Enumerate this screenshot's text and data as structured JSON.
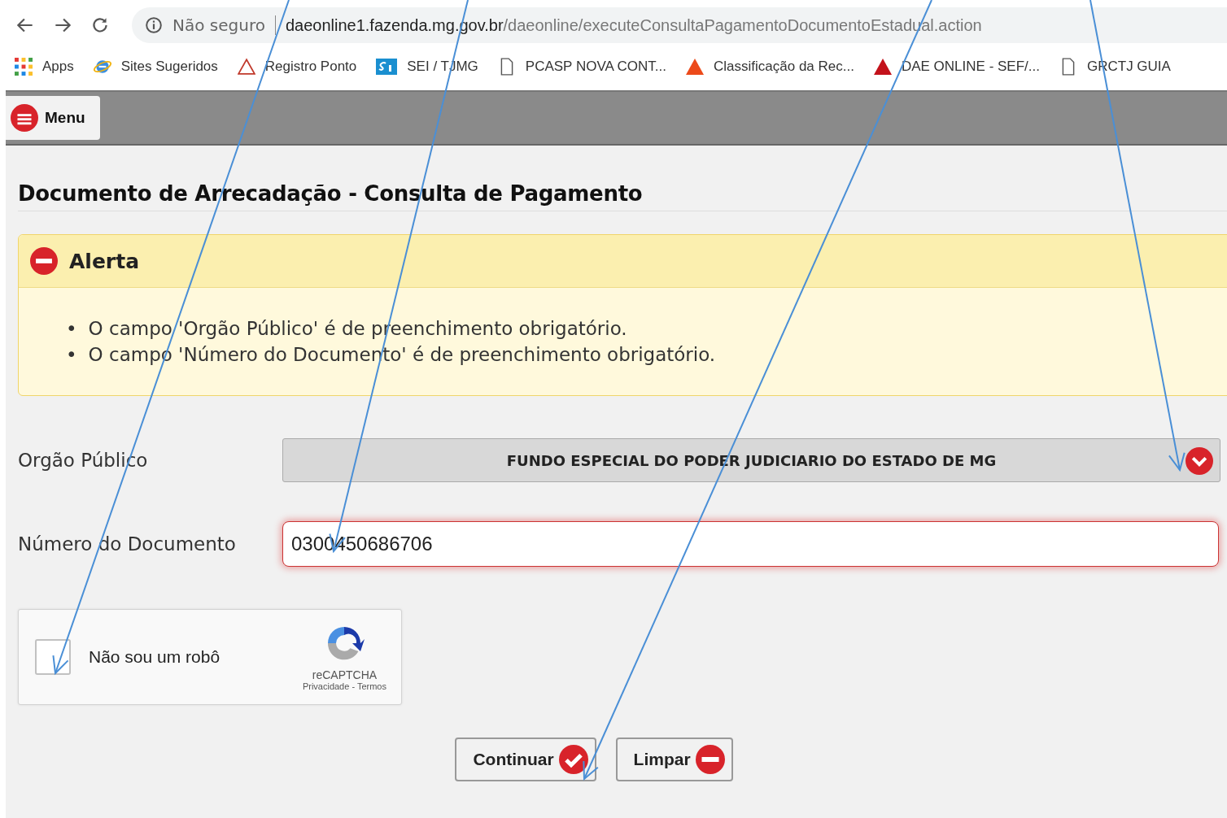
{
  "browser": {
    "security": "Não seguro",
    "url_host": "daeonline1.fazenda.mg.gov.br",
    "url_path": "/daeonline/executeConsultaPagamentoDocumentoEstadual.action",
    "bookmarks": [
      {
        "kind": "apps",
        "label": "Apps"
      },
      {
        "kind": "ie",
        "label": "Sites Sugeridos"
      },
      {
        "kind": "outline-triangle",
        "label": "Registro Ponto"
      },
      {
        "kind": "sei",
        "label": "SEI / TJMG"
      },
      {
        "kind": "page",
        "label": "PCASP NOVA CONT..."
      },
      {
        "kind": "orange-triangle",
        "label": "Classificação da Rec..."
      },
      {
        "kind": "red-triangle",
        "label": "DAE ONLINE - SEF/..."
      },
      {
        "kind": "page",
        "label": "GRCTJ GUIA"
      }
    ]
  },
  "menu_button": "Menu",
  "title": "Documento de Arrecadação - Consulta de Pagamento",
  "alert": {
    "title": "Alerta",
    "bullet": "•",
    "messages": [
      "O campo 'Orgão Público' é de preenchimento obrigatório.",
      "O campo 'Número do Documento' é de preenchimento obrigatório."
    ]
  },
  "form": {
    "orgao": {
      "label": "Orgão Público",
      "value": "FUNDO ESPECIAL DO PODER JUDICIARIO DO ESTADO DE MG"
    },
    "numero": {
      "label": "Número do Documento",
      "value": "0300450686706",
      "error": true
    }
  },
  "captcha": {
    "label": "Não sou um robô",
    "checked": false,
    "brand": "reCAPTCHA",
    "links": "Privacidade - Termos"
  },
  "buttons": [
    {
      "kind": "confirm",
      "label": "Continuar"
    },
    {
      "kind": "clear",
      "label": "Limpar"
    }
  ]
}
